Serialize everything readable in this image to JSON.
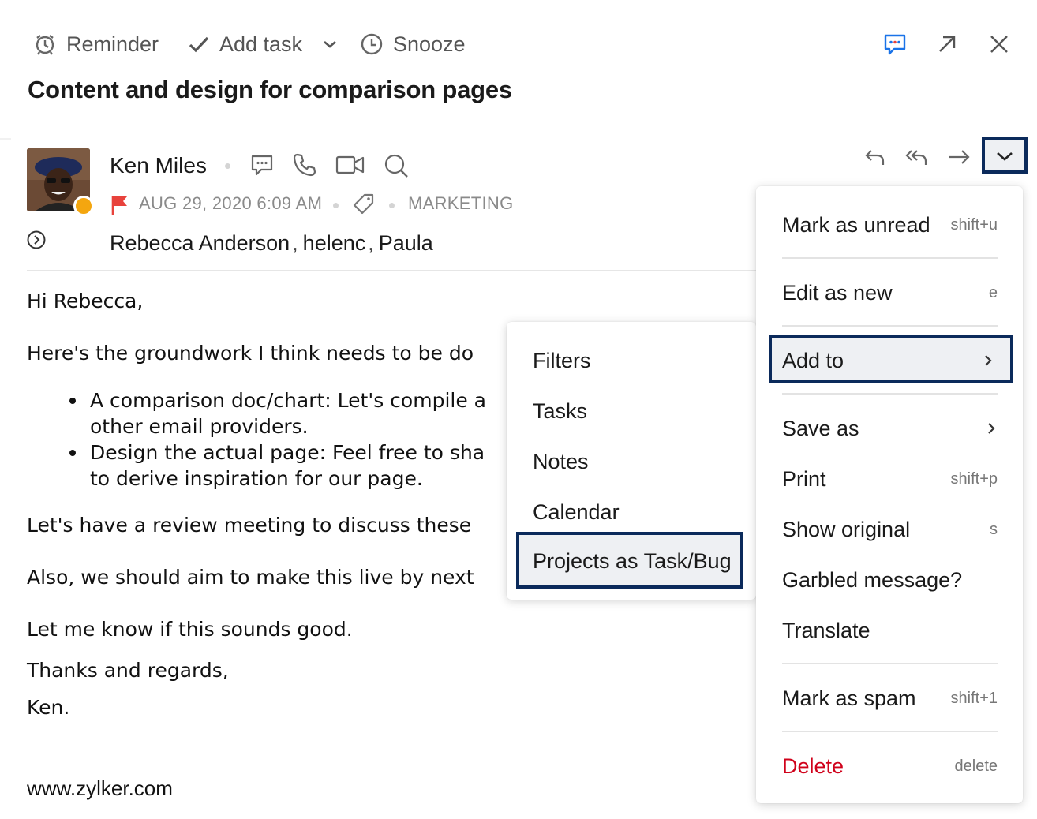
{
  "toolbar": {
    "reminder": "Reminder",
    "add_task": "Add task",
    "snooze": "Snooze"
  },
  "subject": "Content and design for comparison pages",
  "sender": {
    "name": "Ken Miles",
    "date": "AUG 29, 2020 6:09 AM",
    "folder": "MARKETING",
    "presence_color": "#f4a60f"
  },
  "recipients": [
    "Rebecca Anderson",
    "helenc",
    "Paula"
  ],
  "body": {
    "greeting": "Hi Rebecca,",
    "line1": "Here's the groundwork I think needs to be do",
    "bullet1_a": "A comparison doc/chart: Let's compile a",
    "bullet1_b": "other email providers.",
    "bullet2_a": "Design the actual page: Feel free to sha",
    "bullet2_b": "to derive inspiration for our page.",
    "line2": "Let's have a review meeting to discuss these",
    "line3": "Also, we should aim to make this live by next",
    "line4": "Let me know if this sounds good.",
    "sign1": "Thanks and regards,",
    "sign2": "Ken.",
    "website": "www.zylker.com"
  },
  "more_menu": {
    "mark_unread": {
      "label": "Mark as unread",
      "shortcut": "shift+u"
    },
    "edit_new": {
      "label": "Edit as new",
      "shortcut": "e"
    },
    "add_to": {
      "label": "Add to"
    },
    "save_as": {
      "label": "Save as"
    },
    "print": {
      "label": "Print",
      "shortcut": "shift+p"
    },
    "show_original": {
      "label": "Show original",
      "shortcut": "s"
    },
    "garbled": {
      "label": "Garbled message?"
    },
    "translate": {
      "label": "Translate"
    },
    "spam": {
      "label": "Mark as spam",
      "shortcut": "shift+1"
    },
    "delete": {
      "label": "Delete",
      "shortcut": "delete"
    }
  },
  "add_to_submenu": {
    "filters": "Filters",
    "tasks": "Tasks",
    "notes": "Notes",
    "calendar": "Calendar",
    "projects": "Projects as Task/Bug"
  },
  "colors": {
    "accent": "#0b2a5b",
    "delete": "#d0021b",
    "icon_blue": "#1a73e8",
    "flag": "#e8423c"
  }
}
